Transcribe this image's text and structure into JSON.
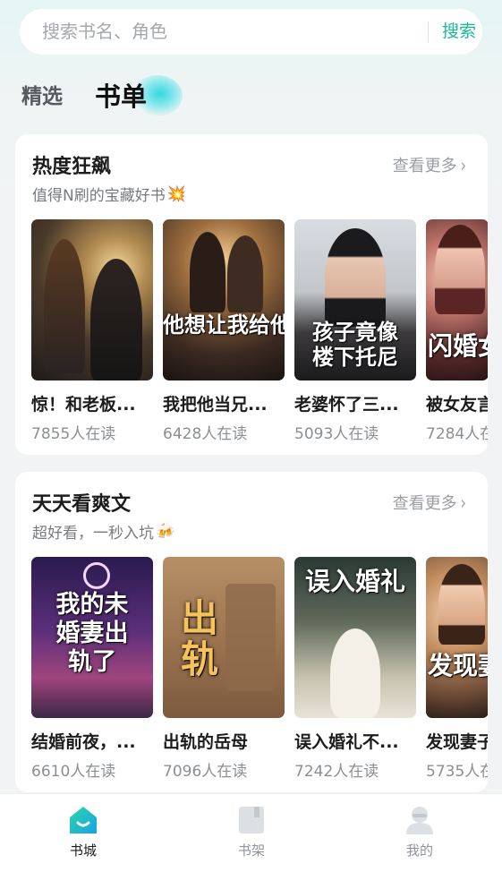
{
  "search": {
    "placeholder": "搜索书名、角色",
    "button_label": "搜索"
  },
  "tabs": [
    {
      "label": "精选",
      "active": false
    },
    {
      "label": "书单",
      "active": true
    }
  ],
  "sections": [
    {
      "title": "热度狂飙",
      "subtitle": "值得N刷的宝藏好书",
      "subtitle_emoji": "💥",
      "see_more": "查看更多",
      "books": [
        {
          "title": "惊！和老板...",
          "readers": "7855人在读",
          "cover_text": ""
        },
        {
          "title": "我把他当兄...",
          "readers": "6428人在读",
          "cover_text": "他想让我给他生孩子"
        },
        {
          "title": "老婆怀了三...",
          "readers": "5093人在读",
          "cover_text": "孩子竟像楼下托尼"
        },
        {
          "title": "被女友言",
          "readers": "7284人在",
          "cover_text": "闪婚女"
        }
      ]
    },
    {
      "title": "天天看爽文",
      "subtitle": "超好看，一秒入坑",
      "subtitle_emoji": "🍻",
      "see_more": "查看更多",
      "books": [
        {
          "title": "结婚前夜，...",
          "readers": "6610人在读",
          "cover_text": "我的未婚妻出轨了"
        },
        {
          "title": "出轨的岳母",
          "readers": "7096人在读",
          "cover_text": "出轨"
        },
        {
          "title": "误入婚礼不...",
          "readers": "7242人在读",
          "cover_text": "误入婚礼"
        },
        {
          "title": "发现妻子",
          "readers": "5735人在",
          "cover_text": "发现妻"
        }
      ]
    }
  ],
  "bottom_nav": [
    {
      "label": "书城",
      "icon": "home-icon",
      "active": true
    },
    {
      "label": "书架",
      "icon": "book-shelf-icon",
      "active": false
    },
    {
      "label": "我的",
      "icon": "profile-icon",
      "active": false
    }
  ],
  "colors": {
    "accent": "#1cb89a",
    "tab_glow": "#28d7dc"
  }
}
